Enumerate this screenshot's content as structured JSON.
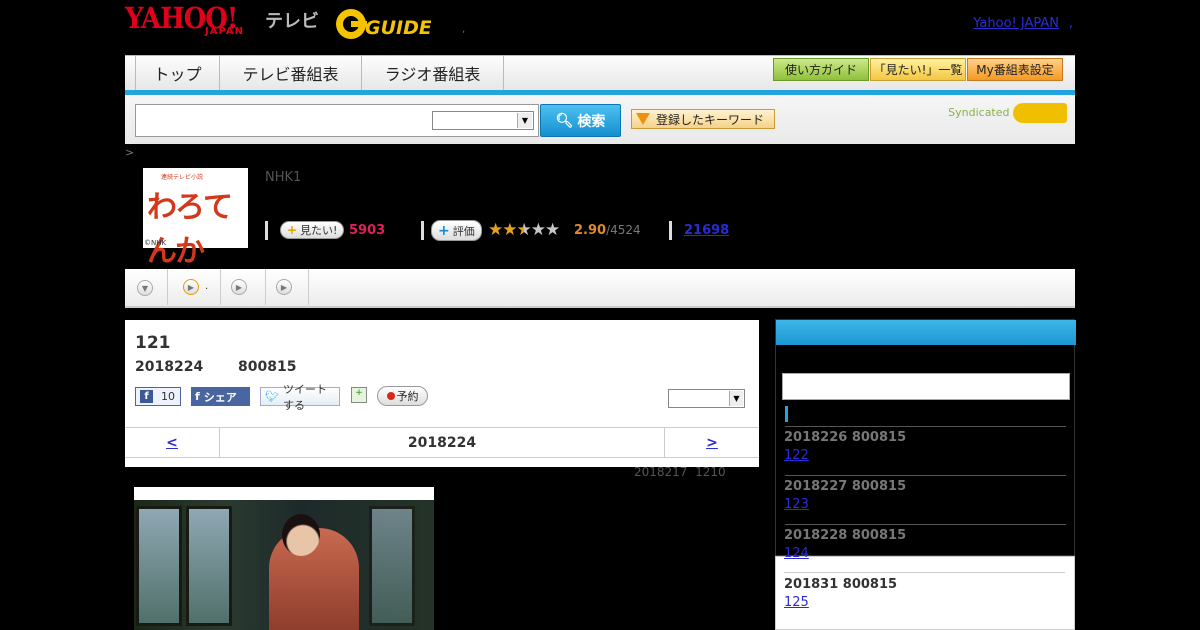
{
  "header": {
    "logo_yahoo": "YAHOO!",
    "logo_japan": "JAPAN",
    "logo_tv": "テレビ",
    "logo_gguide": "GUIDE",
    "dot": ",",
    "yahoo_japan_link": "Yahoo! JAPAN",
    "comma": ","
  },
  "nav": {
    "tabs": [
      "トップ",
      "テレビ番組表",
      "ラジオ番組表"
    ],
    "guide_button": "使い方ガイド",
    "mitai_list_button": "「見たい!」一覧",
    "my_guide_button": "My番組表設定"
  },
  "search": {
    "button_label": "検索",
    "keyword_button": "登録したキーワード",
    "syndicated": "Syndicated"
  },
  "program": {
    "breadcrumb": ">",
    "thumb_title": "わろてんか",
    "thumb_small": "連続テレビ小説",
    "thumb_copyright": "©NHK",
    "channel": "NHK1",
    "mitai_label": "見たい!",
    "mitai_count": "5903",
    "rating_label": "評価",
    "rating_value": "2.90",
    "rating_total": "/4524",
    "link_count": "21698",
    "stars": "★★★★★"
  },
  "tabs": {
    "tab2_suffix": "."
  },
  "episode": {
    "number": "121",
    "date": "2018224",
    "time": "800815",
    "fb_like_count": "10",
    "fb_share": "シェア",
    "tweet": "ツイートする",
    "reserve": "予約",
    "pager_prev": "<",
    "pager_date": "2018224",
    "pager_next": ">",
    "updated_date": "2018217",
    "updated_time": "1210"
  },
  "sidebar": {
    "episodes": [
      {
        "date": "2018226  800815",
        "title": "122"
      },
      {
        "date": "2018227  800815",
        "title": "123"
      },
      {
        "date": "2018228  800815",
        "title": "124"
      },
      {
        "date": "201831  800815",
        "title": "125"
      }
    ]
  },
  "colors": {
    "accent": "#22a5df",
    "brand_red": "#e0001c",
    "mitai_pink": "#e0205a",
    "rating_orange": "#e08a2a"
  }
}
